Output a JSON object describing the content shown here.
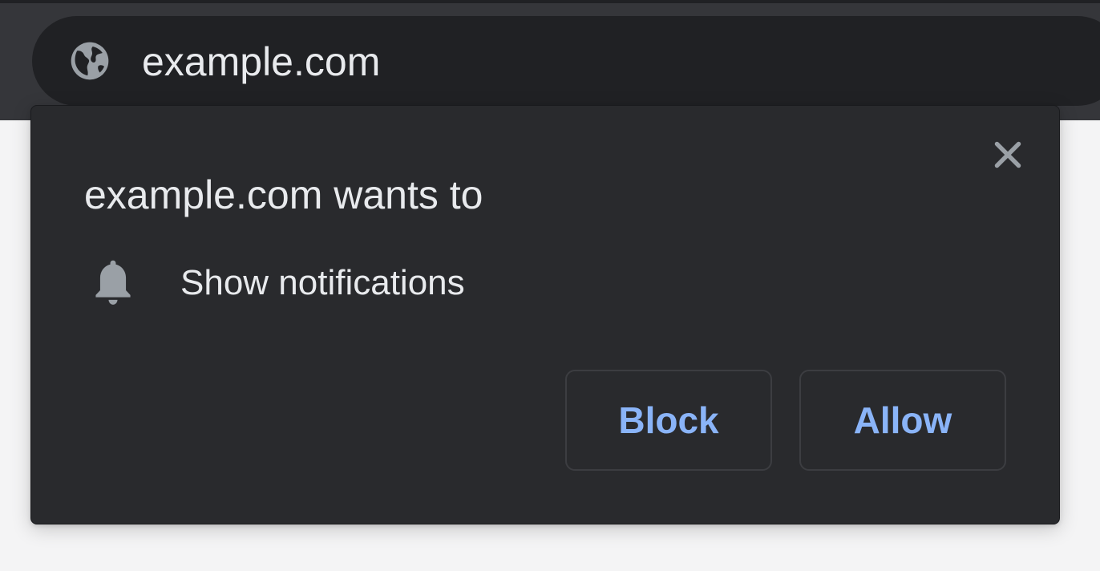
{
  "address_bar": {
    "url": "example.com",
    "site_icon": "globe-icon"
  },
  "prompt": {
    "title": "example.com wants to",
    "permission": {
      "icon": "bell-icon",
      "label": "Show notifications"
    },
    "close_icon": "close-icon",
    "buttons": {
      "block_label": "Block",
      "allow_label": "Allow"
    }
  },
  "colors": {
    "toolbar": "#35363a",
    "omnibox": "#202124",
    "bubble": "#292a2d",
    "text": "#e8eaed",
    "icon": "#9aa0a6",
    "accent": "#8ab4f8",
    "page": "#f4f4f5"
  }
}
